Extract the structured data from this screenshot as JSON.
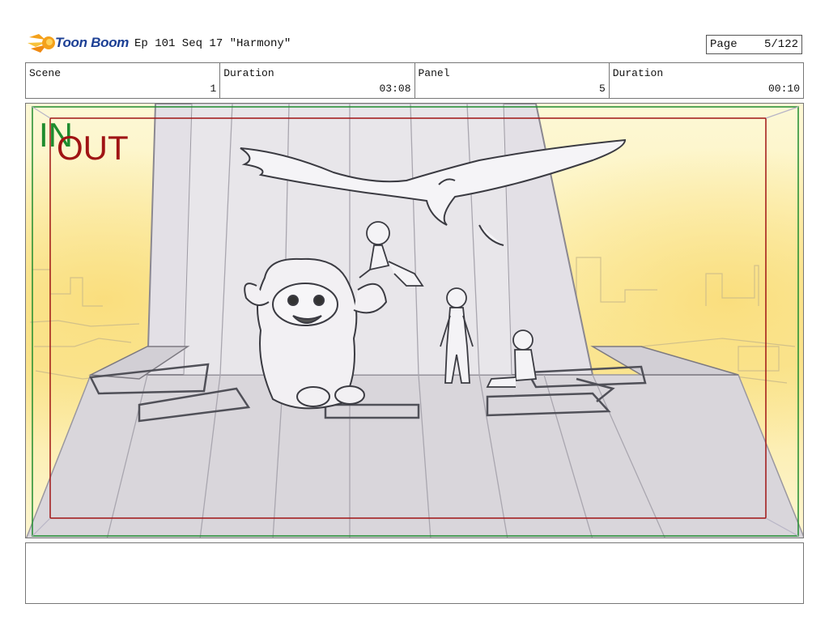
{
  "header": {
    "logo_text": "Toon Boom",
    "title": "Ep 101 Seq 17 \"Harmony\"",
    "page_label": "Page",
    "page_value": "5/122"
  },
  "info": {
    "scene_label": "Scene",
    "scene_value": "1",
    "scene_duration_label": "Duration",
    "scene_duration_value": "03:08",
    "panel_label": "Panel",
    "panel_value": "5",
    "panel_duration_label": "Duration",
    "panel_duration_value": "00:10"
  },
  "panel": {
    "in_label": "IN",
    "out_label": "OUT",
    "in_color": "#1e8c2e",
    "out_color": "#a01414"
  },
  "notes": {
    "text": ""
  },
  "colors": {
    "logo_blue": "#1c3f94",
    "logo_orange": "#f4a11b",
    "sky_yellow": "#fdf3b3"
  }
}
